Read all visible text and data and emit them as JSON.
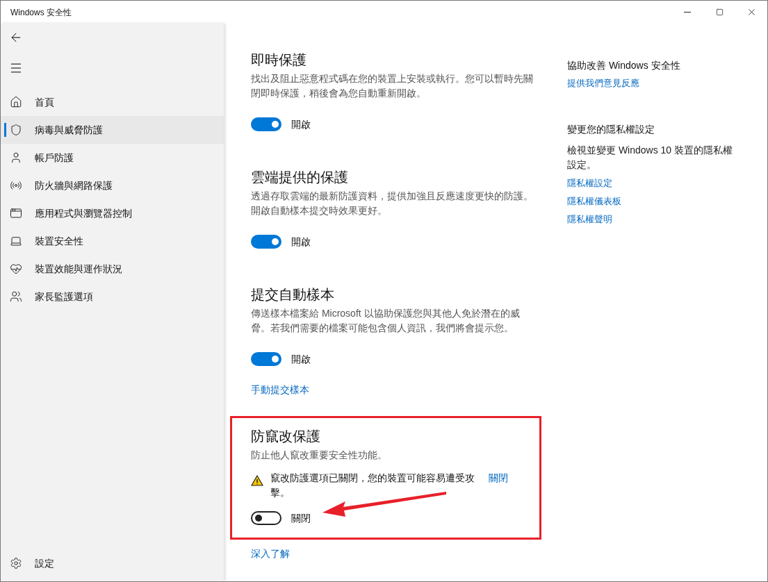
{
  "window": {
    "title": "Windows 安全性"
  },
  "sidebar": {
    "items": [
      {
        "label": "首頁",
        "selected": false
      },
      {
        "label": "病毒與威脅防護",
        "selected": true
      },
      {
        "label": "帳戶防護",
        "selected": false
      },
      {
        "label": "防火牆與網路保護",
        "selected": false
      },
      {
        "label": "應用程式與瀏覽器控制",
        "selected": false
      },
      {
        "label": "裝置安全性",
        "selected": false
      },
      {
        "label": "裝置效能與運作狀況",
        "selected": false
      },
      {
        "label": "家長監護選項",
        "selected": false
      }
    ],
    "footer_item": {
      "label": "設定",
      "selected": false
    }
  },
  "sections": [
    {
      "title": "即時保護",
      "description": "找出及阻止惡意程式碼在您的裝置上安裝或執行。您可以暫時先關閉即時保護，稍後會為您自動重新開啟。",
      "toggle": {
        "on": true,
        "label": "開啟"
      },
      "highlighted": false
    },
    {
      "title": "雲端提供的保護",
      "description": "透過存取雲端的最新防護資料，提供加強且反應速度更快的防護。開啟自動樣本提交時效果更好。",
      "toggle": {
        "on": true,
        "label": "開啟"
      },
      "highlighted": false
    },
    {
      "title": "提交自動樣本",
      "description": "傳送樣本檔案給 Microsoft 以協助保護您與其他人免於潛在的威脅。若我們需要的檔案可能包含個人資訊，我們將會提示您。",
      "toggle": {
        "on": true,
        "label": "開啟"
      },
      "link": "手動提交樣本",
      "highlighted": false
    },
    {
      "title": "防竄改保護",
      "description": "防止他人竄改重要安全性功能。",
      "warning": {
        "text": "竄改防護選項已關閉，您的裝置可能容易遭受攻擊。",
        "action": "關閉"
      },
      "toggle": {
        "on": false,
        "label": "關閉"
      },
      "highlighted": true
    }
  ],
  "footer_link": "深入了解",
  "aside": [
    {
      "heading": "協助改善 Windows 安全性",
      "links": [
        "提供我們意見反應"
      ]
    },
    {
      "heading": "變更您的隱私權設定",
      "description": "檢視並變更 Windows 10 裝置的隱私權設定。",
      "links": [
        "隱私權設定",
        "隱私權儀表板",
        "隱私權聲明"
      ]
    }
  ]
}
